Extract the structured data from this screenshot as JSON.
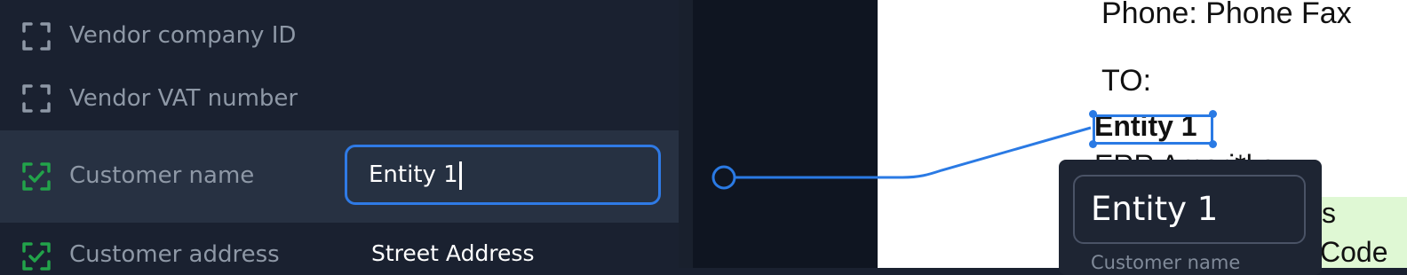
{
  "fields": [
    {
      "label": "Vendor company ID",
      "icon": "scan-frame-icon",
      "status": "empty",
      "value": ""
    },
    {
      "label": "Vendor VAT number",
      "icon": "scan-frame-icon",
      "status": "empty",
      "value": ""
    },
    {
      "label": "Customer name",
      "icon": "scan-check-icon",
      "status": "matched",
      "value": "Entity 1"
    },
    {
      "label": "Customer address",
      "icon": "scan-check-icon",
      "status": "matched",
      "value": "Street Address"
    }
  ],
  "document": {
    "line_phone": "Phone: Phone Fax",
    "line_to": "TO:",
    "selected_text": "Entity 1",
    "partial_line": "ERR Ameri*ka",
    "highlight_line1": "s",
    "highlight_line2": "Code"
  },
  "popup": {
    "value": "Entity 1",
    "caption": "Customer name"
  },
  "colors": {
    "accent": "#2f7ae5",
    "matched_icon": "#22a34a",
    "empty_icon": "#8e98a6",
    "panel_bg": "#1a2130",
    "active_row_bg": "#273142",
    "document_highlight": "#dff8d4"
  }
}
